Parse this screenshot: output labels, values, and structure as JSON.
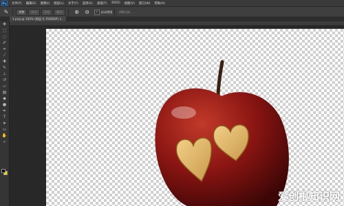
{
  "app": {
    "logo": "Ps"
  },
  "menu": [
    "文件(F)",
    "编辑(E)",
    "图像(I)",
    "图层(L)",
    "文字(Y)",
    "选择(S)",
    "滤镜(T)",
    "3D(D)",
    "视图(V)",
    "窗口(W)",
    "帮助(H)"
  ],
  "options": {
    "tool_icon": "brush-tool-icon",
    "buttons": [
      "调整",
      "样式",
      "羽化",
      "模式"
    ],
    "auto_enhance_label": "自动增强",
    "refine_edge_label": "调整边缘..."
  },
  "document": {
    "tab_title": "1.png @ 100% (图层 0, RGB/8#) ×"
  },
  "tools": [
    "move-tool",
    "marquee-tool",
    "lasso-tool",
    "quick-select-tool",
    "crop-tool",
    "eyedropper-tool",
    "healing-brush-tool",
    "brush-tool",
    "clone-stamp-tool",
    "history-brush-tool",
    "eraser-tool",
    "gradient-tool",
    "blur-tool",
    "dodge-tool",
    "pen-tool",
    "type-tool",
    "path-select-tool",
    "shape-tool",
    "hand-tool",
    "zoom-tool"
  ],
  "colors": {
    "foreground": "#000000",
    "background": "#f0d800",
    "canvas_checker": "#cfcfcf",
    "apple_red": "#8a1512"
  },
  "watermark": "爱创根知识网"
}
